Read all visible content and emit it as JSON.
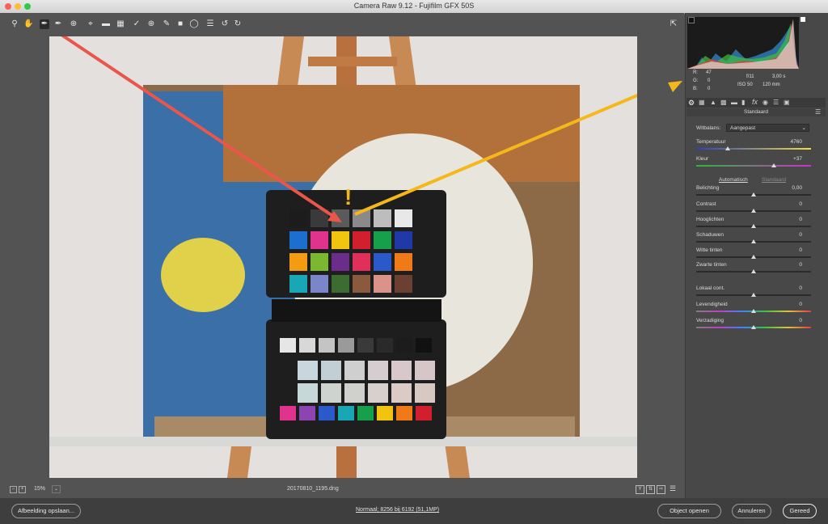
{
  "window": {
    "title": "Camera Raw 9.12  -  Fujifilm GFX 50S"
  },
  "colors": {
    "close": "#fc605c",
    "minimize": "#fdbc40",
    "zoom": "#34c84a",
    "arrow_red": "#e8574a",
    "arrow_yellow": "#f5b81c"
  },
  "toolbar": {
    "tools": [
      "zoom-tool-icon",
      "hand-tool-icon",
      "white-balance-tool-icon",
      "color-sampler-icon",
      "targeted-adjustment-icon",
      "crop-tool-icon",
      "straighten-tool-icon",
      "spot-removal-icon",
      "red-eye-icon",
      "adjustment-brush-icon",
      "graduated-filter-icon",
      "radial-filter-icon",
      "preferences-icon",
      "rotate-ccw-icon",
      "rotate-cw-icon"
    ]
  },
  "info": {
    "r_label": "R:",
    "r_value": "47",
    "g_label": "G:",
    "g_value": "0",
    "b_label": "B:",
    "b_value": "0",
    "aperture": "f/11",
    "shutter": "3,00 s",
    "iso": "ISO 50",
    "focal": "120 mm"
  },
  "panel": {
    "section_title": "Standaard",
    "wb_label": "Witbalans:",
    "wb_value": "Aangepast",
    "temperature_label": "Temperatuur",
    "temperature_value": "4760",
    "tint_label": "Kleur",
    "tint_value": "+37",
    "auto_link": "Automatisch",
    "default_link": "Standaard",
    "sliders": [
      {
        "label": "Belichting",
        "value": "0,00"
      },
      {
        "label": "Contrast",
        "value": "0"
      },
      {
        "label": "Hooglichten",
        "value": "0"
      },
      {
        "label": "Schaduwen",
        "value": "0"
      },
      {
        "label": "Witte tinten",
        "value": "0"
      },
      {
        "label": "Zwarte tinten",
        "value": "0"
      },
      {
        "label": "Lokaal cont.",
        "value": "0"
      },
      {
        "label": "Levendigheid",
        "value": "0"
      },
      {
        "label": "Verzadiging",
        "value": "0"
      }
    ]
  },
  "bottom": {
    "zoom": "15%",
    "filename": "20170810_1195.dng"
  },
  "footer": {
    "save_label": "Afbeelding opslaan...",
    "workflow_link": "Normaal; 8256 bij 6192 (51,1MP)",
    "open_label": "Object openen",
    "cancel_label": "Annuleren",
    "done_label": "Gereed"
  }
}
